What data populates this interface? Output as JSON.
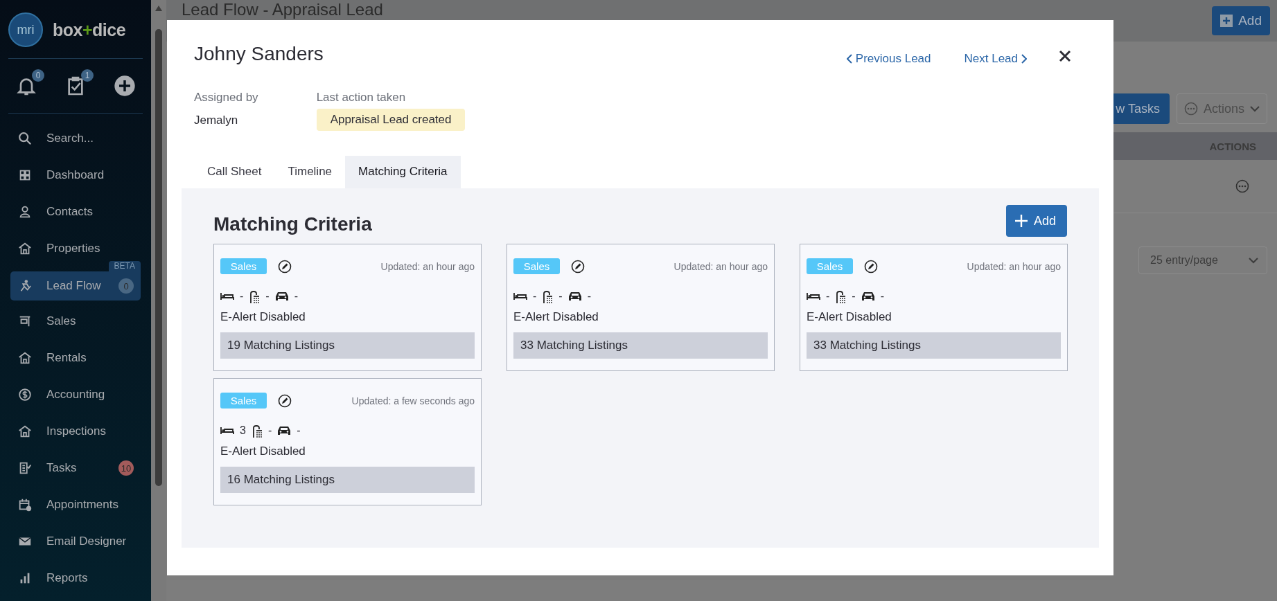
{
  "sidebar": {
    "logo": "mri",
    "brand": {
      "name": "box",
      "accent": "+",
      "suffix": "dice"
    },
    "quick_actions": [
      {
        "kind": "bell",
        "badge": "0"
      },
      {
        "kind": "tasks",
        "badge": "1"
      },
      {
        "kind": "add"
      }
    ],
    "nav": [
      {
        "kind": "search",
        "label": "Search...",
        "selected": false
      },
      {
        "kind": "grid",
        "label": "Dashboard",
        "selected": false
      },
      {
        "kind": "person",
        "label": "Contacts",
        "selected": false
      },
      {
        "kind": "house",
        "label": "Properties",
        "selected": false
      },
      {
        "kind": "runner",
        "label": "Lead Flow",
        "selected": true,
        "tag": "BETA",
        "badge": {
          "text": "0",
          "color": "#496783"
        }
      },
      {
        "kind": "sign",
        "label": "Sales",
        "selected": false
      },
      {
        "kind": "house",
        "label": "Rentals",
        "selected": false
      },
      {
        "kind": "dollar",
        "label": "Accounting",
        "selected": false
      },
      {
        "kind": "house",
        "label": "Inspections",
        "selected": false
      },
      {
        "kind": "checklist",
        "label": "Tasks",
        "selected": false,
        "badge": {
          "text": "10",
          "color": "#a35b5b"
        }
      },
      {
        "kind": "calendar",
        "label": "Appointments",
        "selected": false
      },
      {
        "kind": "mail",
        "label": "Email Designer",
        "selected": false
      },
      {
        "kind": "bars",
        "label": "Reports",
        "selected": false
      }
    ]
  },
  "page": {
    "title": "Lead Flow - Appraisal Lead",
    "add_button": "Add",
    "tasks_button": "w Tasks",
    "actions_button": "Actions",
    "table_header": "ACTIONS",
    "page_size": "25 entry/page"
  },
  "modal": {
    "name": "Johny Sanders",
    "previous": "Previous Lead",
    "next": "Next Lead",
    "assigned_label": "Assigned by",
    "assigned_value": "Jemalyn",
    "last_action_label": "Last action taken",
    "last_action_value": "Appraisal Lead created",
    "tabs": [
      {
        "label": "Call Sheet",
        "selected": false
      },
      {
        "label": "Timeline",
        "selected": false
      },
      {
        "label": "Matching Criteria",
        "selected": true
      }
    ],
    "section_title": "Matching Criteria",
    "add_button": "Add",
    "criteria": [
      {
        "type": "Sales",
        "updated": "Updated: an hour ago",
        "beds": "-",
        "baths": "-",
        "cars": "-",
        "e_alert": "E-Alert Disabled",
        "matches": "19 Matching Listings"
      },
      {
        "type": "Sales",
        "updated": "Updated: an hour ago",
        "beds": "-",
        "baths": "-",
        "cars": "-",
        "e_alert": "E-Alert Disabled",
        "matches": "33 Matching Listings"
      },
      {
        "type": "Sales",
        "updated": "Updated: an hour ago",
        "beds": "-",
        "baths": "-",
        "cars": "-",
        "e_alert": "E-Alert Disabled",
        "matches": "33 Matching Listings"
      },
      {
        "type": "Sales",
        "updated": "Updated: a few seconds ago",
        "beds": "3",
        "baths": "-",
        "cars": "-",
        "e_alert": "E-Alert Disabled",
        "matches": "16 Matching Listings"
      }
    ]
  }
}
